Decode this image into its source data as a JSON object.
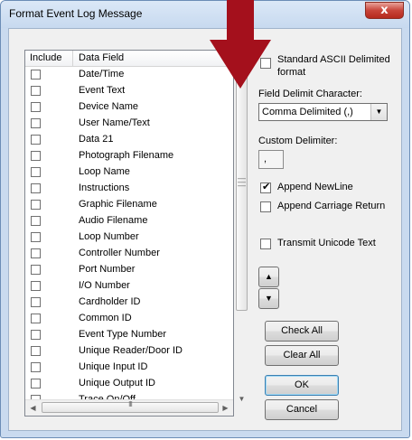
{
  "window": {
    "title": "Format Event Log Message",
    "close_label": "x"
  },
  "list": {
    "columns": [
      "Include",
      "Data Field"
    ],
    "rows": [
      "Date/Time",
      "Event Text",
      "Device Name",
      "User Name/Text",
      "Data 21",
      "Photograph Filename",
      "Loop Name",
      "Instructions",
      "Graphic Filename",
      "Audio Filename",
      "Loop Number",
      "Controller Number",
      "Port Number",
      "I/O Number",
      "Cardholder ID",
      "Common ID",
      "Event Type Number",
      "Unique Reader/Door ID",
      "Unique Input ID",
      "Unique Output ID",
      "Trace On/Off"
    ],
    "scroll_grip": "III"
  },
  "options": {
    "standard_ascii_line1": "Standard ASCII Delimited",
    "standard_ascii_line2": "format",
    "standard_ascii_checked": false,
    "field_delimit_label": "Field Delimit Character:",
    "field_delimit_value": "Comma Delimited (,)",
    "custom_delimiter_label": "Custom Delimiter:",
    "custom_delimiter_value": ",",
    "append_newline_label": "Append NewLine",
    "append_newline_checked": true,
    "append_cr_label": "Append Carriage Return",
    "append_cr_checked": false,
    "transmit_unicode_label": "Transmit Unicode Text",
    "transmit_unicode_checked": false
  },
  "buttons": {
    "check_all": "Check All",
    "clear_all": "Clear All",
    "ok": "OK",
    "cancel": "Cancel"
  },
  "colors": {
    "pointer_arrow": "#a4101c",
    "close_button": "#c8453a",
    "window_frame": "#c9daef"
  }
}
